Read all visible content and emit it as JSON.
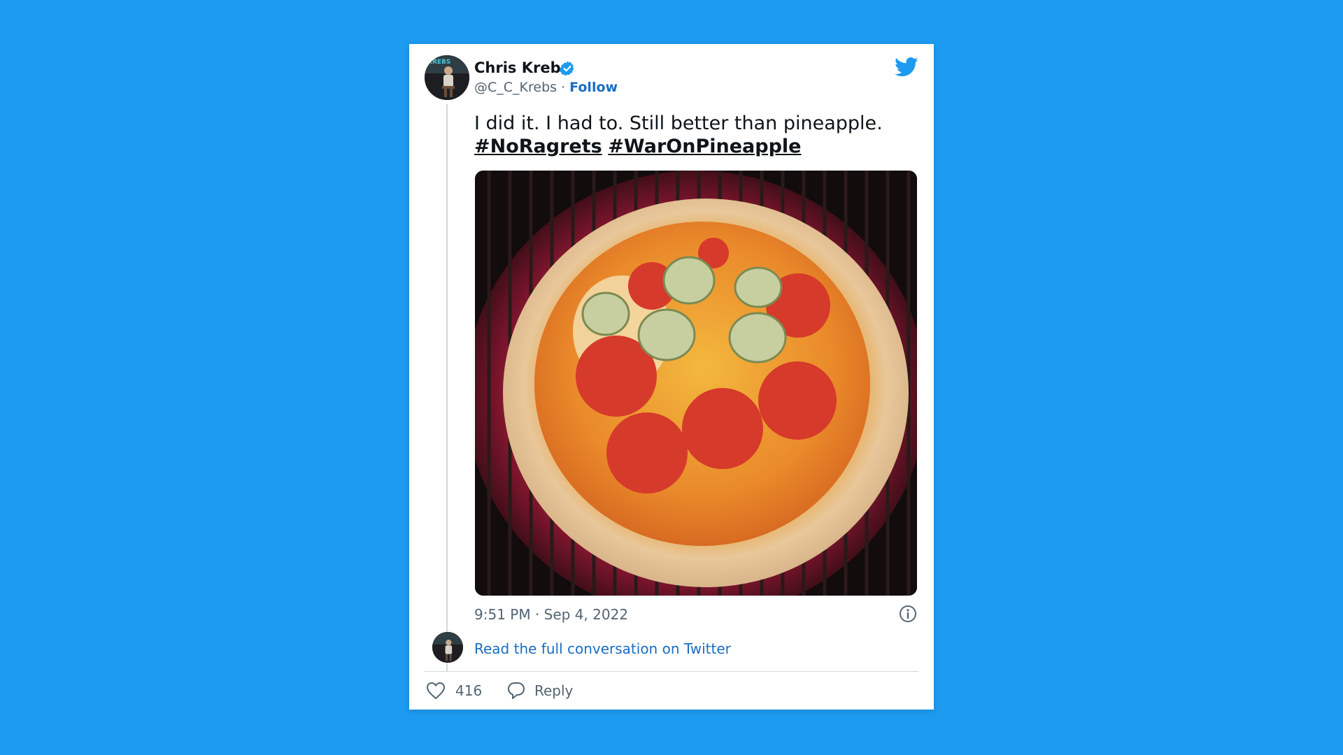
{
  "colors": {
    "background": "#1d9bf0",
    "link": "#1a6dc2",
    "secondary_text": "#536471",
    "verified": "#1d9bf0"
  },
  "tweet": {
    "author_name": "Chris Krebs",
    "handle": "@C_C_Krebs",
    "separator": " · ",
    "follow_label": "Follow",
    "text_line1": "I did it. I had to. Still better than pineapple.",
    "hashtags": [
      "#NoRagrets",
      "#WarOnPineapple"
    ],
    "timestamp": "9:51 PM · Sep 4, 2022",
    "read_more": "Read the full conversation on Twitter",
    "like_count": "416",
    "reply_label": "Reply",
    "media_description_icon": "pizza-photo",
    "avatar_badge_text": "KREBS"
  },
  "icons": {
    "brand": "twitter-bird-icon",
    "verified": "verified-badge-icon",
    "info": "info-icon",
    "like": "heart-icon",
    "reply": "speech-bubble-icon"
  }
}
